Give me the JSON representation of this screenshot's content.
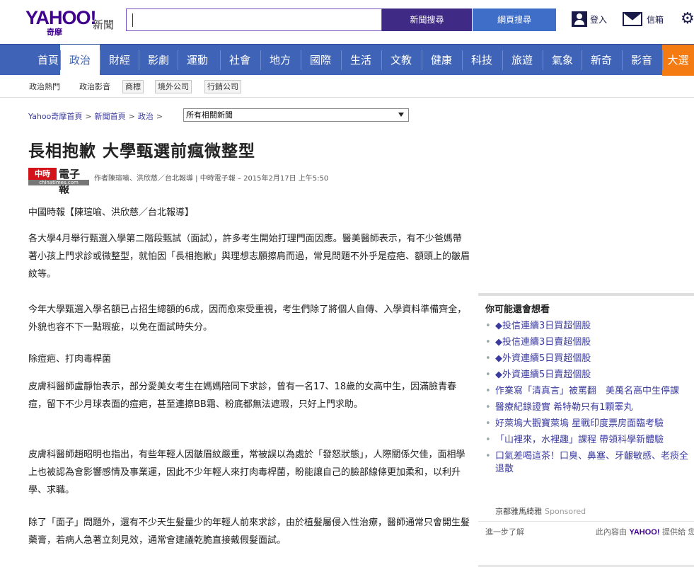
{
  "header": {
    "brand": "YAHOO!",
    "brand_sub": "奇摩",
    "section": "新聞",
    "search_value": "",
    "news_search_label": "新聞搜尋",
    "web_search_label": "網頁搜尋",
    "login_label": "登入",
    "mail_label": "信箱",
    "gear_icon": "gear-icon"
  },
  "nav": {
    "items": [
      "首頁",
      "政治",
      "財經",
      "影劇",
      "運動",
      "社會",
      "地方",
      "國際",
      "生活",
      "文教",
      "健康",
      "科技",
      "旅遊",
      "氣象",
      "新奇",
      "影音",
      "大選"
    ],
    "active": "政治",
    "highlight": "大選",
    "color": "#3f63b6",
    "highlight_color": "#f37b12"
  },
  "subnav": {
    "items": [
      "政治熱門",
      "政治影音",
      "商標",
      "境外公司",
      "行銷公司"
    ]
  },
  "breadcrumb": {
    "items": [
      "Yahoo奇摩首頁",
      "新聞首頁",
      "政治"
    ],
    "select_value": "所有相關新聞"
  },
  "article": {
    "title": "長相抱歉 大學甄選前瘋微整型",
    "source_mark": "中時",
    "source_name": "電子報",
    "source_sub": "chinatimes.com",
    "byline": "作者陳瑄喻、洪欣慈／台北報導 | 中時電子報 – 2015年2月17日 上午5:50",
    "paragraphs": [
      "中國時報【陳瑄喻、洪欣慈／台北報導】",
      "各大學4月舉行甄選入學第二階段甄試（面試），許多考生開始打理門面因應。醫美醫師表示，有不少爸媽帶著小孩上門求診或微整型，就怕因「長相抱歉」與理想志願擦肩而過，常見問題不外乎是痘疤、額頭上的皺眉紋等。",
      "今年大學甄選入學名額已占招生總額的6成，因而愈來受重視，考生們除了將個人自傳、入學資料準備齊全，外貌也容不下一點瑕疵，以免在面試時失分。",
      "除痘疤、打肉毒桿菌",
      "皮膚科醫師盧靜怡表示，部分愛美女考生在媽媽陪同下求診，曾有一名17、18歲的女高中生，因滿臉青春痘，留下不少月球表面的痘疤，甚至連擦BB霜、粉底都無法遮瑕，只好上門求助。",
      "皮膚科醫師趙昭明也指出，有些年輕人因皺眉紋嚴重，常被誤以為處於「發怒狀態」，人際關係欠佳，面相學上也被認為會影響感情及事業運，因此不少年輕人來打肉毒桿菌，盼能讓自己的臉部線條更加柔和，以利升學、求職。",
      "除了「面子」問題外，還有不少天生髮量少的年輕人前來求診，由於植髮屬侵入性治療，醫師通常只會開生髮藥膏，若病人急著立刻見效，通常會建議乾脆直接戴假髮面試。"
    ]
  },
  "sidebar": {
    "heading": "你可能還會想看",
    "items": [
      "◆投信連續3日買超個股",
      "◆投信連續3日賣超個股",
      "◆外資連續5日買超個股",
      "◆外資連續5日賣超個股",
      "作業寫「清真言」被罵翻　美萬名高中生停課",
      "醫療紀錄證實 希特勒只有1顆睪丸",
      "好萊塢大觀寶萊塢 星戰印度票房面臨考驗",
      "「山裡來，水裡趣」課程 帶領科學新體驗",
      "口氣差喝這茶！口臭、鼻塞、牙齦敏感、老痰全退散"
    ],
    "sponsor_name": "京都雅馬綺雅",
    "sponsor_label": "Sponsored",
    "footer_left": "進一步了解",
    "footer_right_prefix": "此內容由",
    "footer_right_brand": "YAHOO!",
    "footer_right_suffix": "提供給 您"
  }
}
